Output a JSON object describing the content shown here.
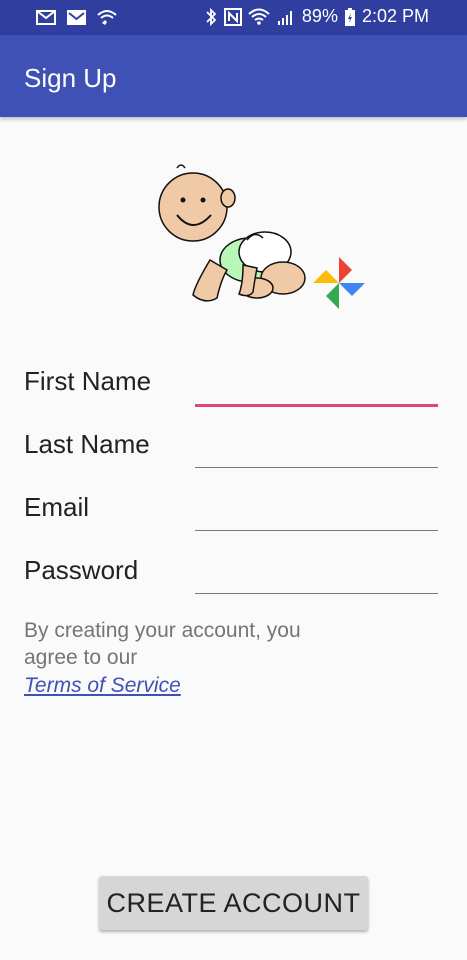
{
  "status_bar": {
    "battery": "89%",
    "time": "2:02 PM"
  },
  "app_bar": {
    "title": "Sign Up"
  },
  "form": {
    "first_name_label": "First Name",
    "last_name_label": "Last Name",
    "email_label": "Email",
    "password_label": "Password",
    "first_name_value": "",
    "last_name_value": "",
    "email_value": "",
    "password_value": ""
  },
  "terms": {
    "text": "By creating your account, you agree to our",
    "link": "Terms of Service"
  },
  "create_button": {
    "label": "CREATE ACCOUNT"
  },
  "colors": {
    "primary": "#3f51b5",
    "primary_dark": "#303f9f",
    "accent": "#e0457b"
  }
}
